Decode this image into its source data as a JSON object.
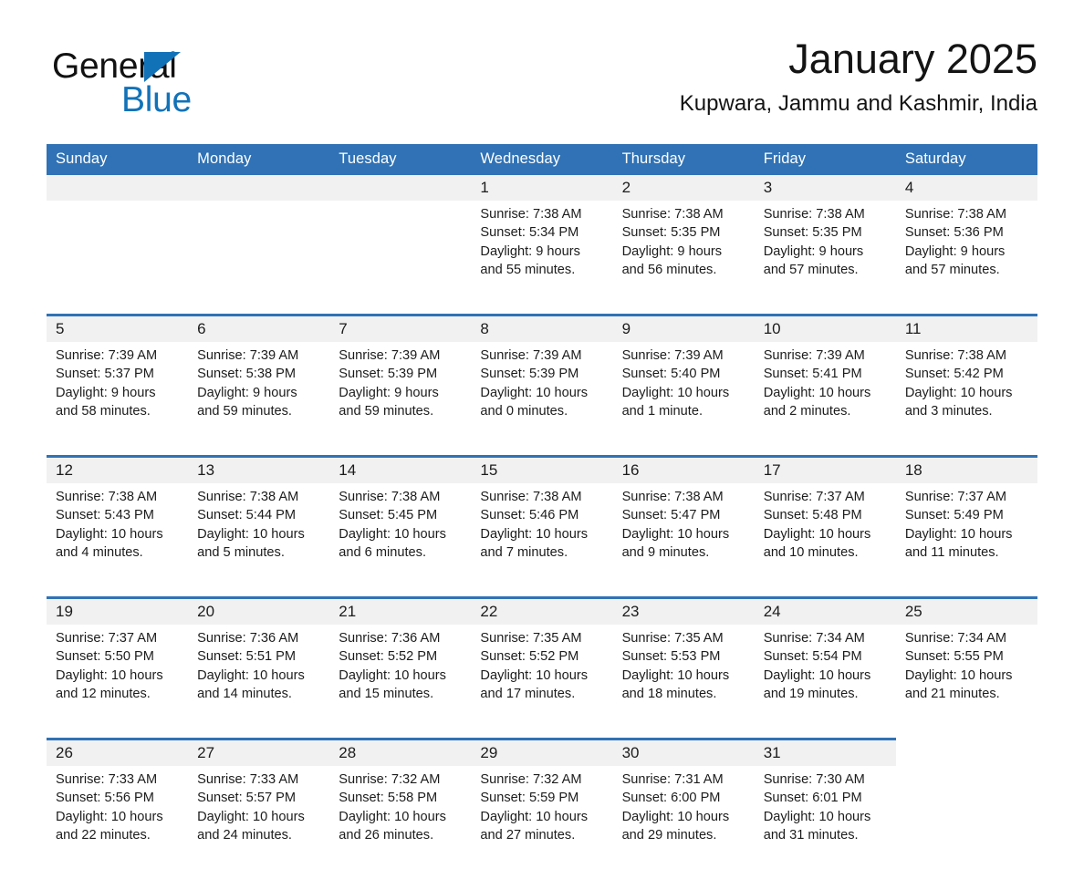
{
  "brand": {
    "logo_text_1": "General",
    "logo_text_2": "Blue",
    "logo_accent_color": "#1272b8",
    "icon": "flag-triangle-icon"
  },
  "header": {
    "month_title": "January 2025",
    "location": "Kupwara, Jammu and Kashmir, India"
  },
  "calendar": {
    "header_bg": "#3072b5",
    "daynum_bg": "#f1f1f1",
    "weekday_headers": [
      "Sunday",
      "Monday",
      "Tuesday",
      "Wednesday",
      "Thursday",
      "Friday",
      "Saturday"
    ],
    "weeks": [
      [
        {
          "day": "",
          "sunrise": "",
          "sunset": "",
          "daylight": ""
        },
        {
          "day": "",
          "sunrise": "",
          "sunset": "",
          "daylight": ""
        },
        {
          "day": "",
          "sunrise": "",
          "sunset": "",
          "daylight": ""
        },
        {
          "day": "1",
          "sunrise": "Sunrise: 7:38 AM",
          "sunset": "Sunset: 5:34 PM",
          "daylight": "Daylight: 9 hours and 55 minutes."
        },
        {
          "day": "2",
          "sunrise": "Sunrise: 7:38 AM",
          "sunset": "Sunset: 5:35 PM",
          "daylight": "Daylight: 9 hours and 56 minutes."
        },
        {
          "day": "3",
          "sunrise": "Sunrise: 7:38 AM",
          "sunset": "Sunset: 5:35 PM",
          "daylight": "Daylight: 9 hours and 57 minutes."
        },
        {
          "day": "4",
          "sunrise": "Sunrise: 7:38 AM",
          "sunset": "Sunset: 5:36 PM",
          "daylight": "Daylight: 9 hours and 57 minutes."
        }
      ],
      [
        {
          "day": "5",
          "sunrise": "Sunrise: 7:39 AM",
          "sunset": "Sunset: 5:37 PM",
          "daylight": "Daylight: 9 hours and 58 minutes."
        },
        {
          "day": "6",
          "sunrise": "Sunrise: 7:39 AM",
          "sunset": "Sunset: 5:38 PM",
          "daylight": "Daylight: 9 hours and 59 minutes."
        },
        {
          "day": "7",
          "sunrise": "Sunrise: 7:39 AM",
          "sunset": "Sunset: 5:39 PM",
          "daylight": "Daylight: 9 hours and 59 minutes."
        },
        {
          "day": "8",
          "sunrise": "Sunrise: 7:39 AM",
          "sunset": "Sunset: 5:39 PM",
          "daylight": "Daylight: 10 hours and 0 minutes."
        },
        {
          "day": "9",
          "sunrise": "Sunrise: 7:39 AM",
          "sunset": "Sunset: 5:40 PM",
          "daylight": "Daylight: 10 hours and 1 minute."
        },
        {
          "day": "10",
          "sunrise": "Sunrise: 7:39 AM",
          "sunset": "Sunset: 5:41 PM",
          "daylight": "Daylight: 10 hours and 2 minutes."
        },
        {
          "day": "11",
          "sunrise": "Sunrise: 7:38 AM",
          "sunset": "Sunset: 5:42 PM",
          "daylight": "Daylight: 10 hours and 3 minutes."
        }
      ],
      [
        {
          "day": "12",
          "sunrise": "Sunrise: 7:38 AM",
          "sunset": "Sunset: 5:43 PM",
          "daylight": "Daylight: 10 hours and 4 minutes."
        },
        {
          "day": "13",
          "sunrise": "Sunrise: 7:38 AM",
          "sunset": "Sunset: 5:44 PM",
          "daylight": "Daylight: 10 hours and 5 minutes."
        },
        {
          "day": "14",
          "sunrise": "Sunrise: 7:38 AM",
          "sunset": "Sunset: 5:45 PM",
          "daylight": "Daylight: 10 hours and 6 minutes."
        },
        {
          "day": "15",
          "sunrise": "Sunrise: 7:38 AM",
          "sunset": "Sunset: 5:46 PM",
          "daylight": "Daylight: 10 hours and 7 minutes."
        },
        {
          "day": "16",
          "sunrise": "Sunrise: 7:38 AM",
          "sunset": "Sunset: 5:47 PM",
          "daylight": "Daylight: 10 hours and 9 minutes."
        },
        {
          "day": "17",
          "sunrise": "Sunrise: 7:37 AM",
          "sunset": "Sunset: 5:48 PM",
          "daylight": "Daylight: 10 hours and 10 minutes."
        },
        {
          "day": "18",
          "sunrise": "Sunrise: 7:37 AM",
          "sunset": "Sunset: 5:49 PM",
          "daylight": "Daylight: 10 hours and 11 minutes."
        }
      ],
      [
        {
          "day": "19",
          "sunrise": "Sunrise: 7:37 AM",
          "sunset": "Sunset: 5:50 PM",
          "daylight": "Daylight: 10 hours and 12 minutes."
        },
        {
          "day": "20",
          "sunrise": "Sunrise: 7:36 AM",
          "sunset": "Sunset: 5:51 PM",
          "daylight": "Daylight: 10 hours and 14 minutes."
        },
        {
          "day": "21",
          "sunrise": "Sunrise: 7:36 AM",
          "sunset": "Sunset: 5:52 PM",
          "daylight": "Daylight: 10 hours and 15 minutes."
        },
        {
          "day": "22",
          "sunrise": "Sunrise: 7:35 AM",
          "sunset": "Sunset: 5:52 PM",
          "daylight": "Daylight: 10 hours and 17 minutes."
        },
        {
          "day": "23",
          "sunrise": "Sunrise: 7:35 AM",
          "sunset": "Sunset: 5:53 PM",
          "daylight": "Daylight: 10 hours and 18 minutes."
        },
        {
          "day": "24",
          "sunrise": "Sunrise: 7:34 AM",
          "sunset": "Sunset: 5:54 PM",
          "daylight": "Daylight: 10 hours and 19 minutes."
        },
        {
          "day": "25",
          "sunrise": "Sunrise: 7:34 AM",
          "sunset": "Sunset: 5:55 PM",
          "daylight": "Daylight: 10 hours and 21 minutes."
        }
      ],
      [
        {
          "day": "26",
          "sunrise": "Sunrise: 7:33 AM",
          "sunset": "Sunset: 5:56 PM",
          "daylight": "Daylight: 10 hours and 22 minutes."
        },
        {
          "day": "27",
          "sunrise": "Sunrise: 7:33 AM",
          "sunset": "Sunset: 5:57 PM",
          "daylight": "Daylight: 10 hours and 24 minutes."
        },
        {
          "day": "28",
          "sunrise": "Sunrise: 7:32 AM",
          "sunset": "Sunset: 5:58 PM",
          "daylight": "Daylight: 10 hours and 26 minutes."
        },
        {
          "day": "29",
          "sunrise": "Sunrise: 7:32 AM",
          "sunset": "Sunset: 5:59 PM",
          "daylight": "Daylight: 10 hours and 27 minutes."
        },
        {
          "day": "30",
          "sunrise": "Sunrise: 7:31 AM",
          "sunset": "Sunset: 6:00 PM",
          "daylight": "Daylight: 10 hours and 29 minutes."
        },
        {
          "day": "31",
          "sunrise": "Sunrise: 7:30 AM",
          "sunset": "Sunset: 6:01 PM",
          "daylight": "Daylight: 10 hours and 31 minutes."
        },
        {
          "day": "",
          "sunrise": "",
          "sunset": "",
          "daylight": ""
        }
      ]
    ]
  }
}
